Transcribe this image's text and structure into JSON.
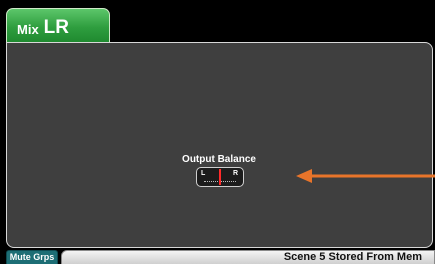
{
  "header": {
    "mix_prefix": "Mix",
    "mix_name": "LR"
  },
  "balance": {
    "title": "Output Balance",
    "left_label": "L",
    "right_label": "R",
    "value": 0.5
  },
  "footer": {
    "mute_groups_label": "Mute Grps",
    "status_message": "Scene 5 Stored From Mem"
  },
  "colors": {
    "tab_green": "#2f9e3f",
    "panel_gray": "#3f3f3f",
    "marker_red": "#ff2a2a",
    "arrow_orange": "#e8742a",
    "mute_teal": "#1d6e75"
  }
}
